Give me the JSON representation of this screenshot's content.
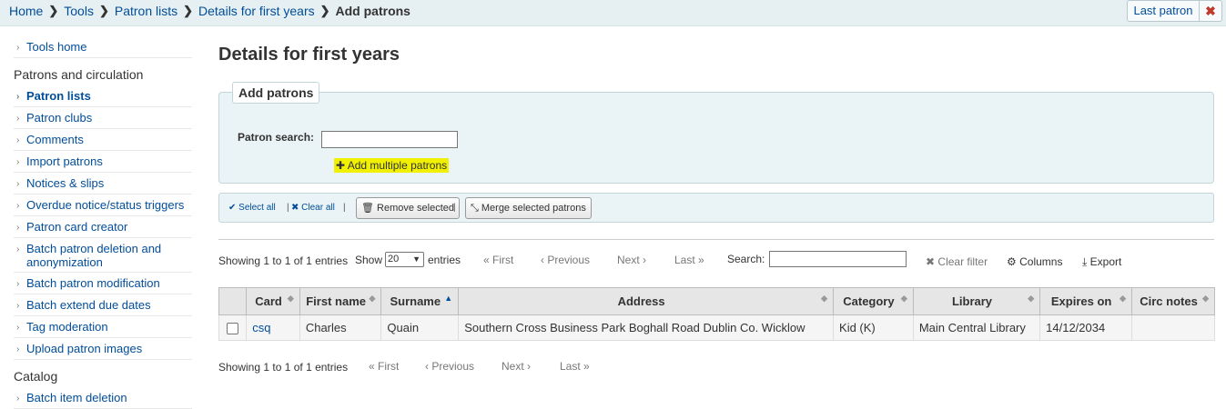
{
  "breadcrumb": {
    "home": "Home",
    "tools": "Tools",
    "patron_lists": "Patron lists",
    "list_details": "Details for first years",
    "current": "Add patrons",
    "separator": "❯"
  },
  "header": {
    "last_patron_label": "Last patron",
    "close_glyph": "✖"
  },
  "sidebar": {
    "tools_home": "Tools home",
    "patrons_heading": "Patrons and circulation",
    "items": [
      {
        "label": "Patron lists",
        "active": true
      },
      {
        "label": "Patron clubs"
      },
      {
        "label": "Comments"
      },
      {
        "label": "Import patrons"
      },
      {
        "label": "Notices & slips"
      },
      {
        "label": "Overdue notice/status triggers"
      },
      {
        "label": "Patron card creator"
      },
      {
        "label": "Batch patron deletion and anonymization"
      },
      {
        "label": "Batch patron modification"
      },
      {
        "label": "Batch extend due dates"
      },
      {
        "label": "Tag moderation"
      },
      {
        "label": "Upload patron images"
      }
    ],
    "catalog_heading": "Catalog",
    "catalog_first_item": "Batch item deletion",
    "arrow": "›"
  },
  "main": {
    "title": "Details for first years",
    "add_patrons": {
      "legend": "Add patrons",
      "search_label": "Patron search:",
      "add_multiple": "Add multiple patrons",
      "plus_glyph": "✚"
    },
    "toolbar": {
      "select_all": "Select all",
      "clear_all": "Clear all",
      "remove_selected": "Remove selected",
      "merge_selected": "Merge selected patrons",
      "separator": "|",
      "check_glyph": "✔",
      "x_glyph": "✖",
      "trash_glyph": "🗑",
      "merge_glyph": "⤡"
    },
    "datatable": {
      "info_top": "Showing 1 to 1 of 1 entries",
      "show_label": "Show",
      "length_value": "20",
      "entries_label": "entries",
      "search_label": "Search:",
      "clear_filter": "Clear filter",
      "columns": "Columns",
      "export": "Export",
      "info_bottom": "Showing 1 to 1 of 1 entries",
      "pager": {
        "first": "« First",
        "previous": "‹ Previous",
        "next": "Next ›",
        "last": "Last »"
      },
      "headers": [
        "Card",
        "First name",
        "Surname",
        "Address",
        "Category",
        "Library",
        "Expires on",
        "Circ notes"
      ],
      "sort_neutral": "◆",
      "sort_asc": "▲",
      "rows": [
        {
          "card": "csq",
          "first_name": "Charles",
          "surname": "Quain",
          "address": "Southern Cross Business Park Boghall Road Dublin Co. Wicklow",
          "category": "Kid (K)",
          "library": "Main Central Library",
          "expires_on": "14/12/2034",
          "circ_notes": ""
        }
      ]
    }
  }
}
